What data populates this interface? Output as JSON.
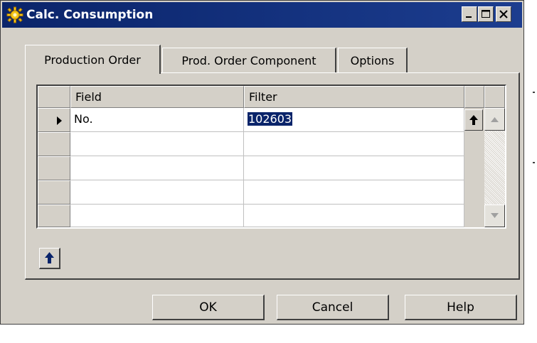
{
  "window": {
    "title": "Calc. Consumption",
    "title_color": "#0a246a"
  },
  "tabs": [
    {
      "label": "Production Order",
      "active": true
    },
    {
      "label": "Prod. Order Component",
      "active": false
    },
    {
      "label": "Options",
      "active": false
    }
  ],
  "grid": {
    "columns": [
      "Field",
      "Filter"
    ],
    "rows": [
      {
        "field": "No.",
        "filter": "102603",
        "current": true
      },
      {
        "field": "",
        "filter": ""
      },
      {
        "field": "",
        "filter": ""
      },
      {
        "field": "",
        "filter": ""
      },
      {
        "field": "",
        "filter": ""
      }
    ]
  },
  "buttons": {
    "ok": "OK",
    "cancel": "Cancel",
    "help": "Help"
  },
  "icons": [
    "app-gear-icon",
    "minimize-icon",
    "maximize-icon",
    "close-icon",
    "row-pointer-icon",
    "lookup-arrow-icon",
    "scroll-up-icon",
    "scroll-down-icon",
    "sort-up-icon"
  ],
  "colors": {
    "face": "#d4d0c8",
    "selection": "#0a246a"
  }
}
